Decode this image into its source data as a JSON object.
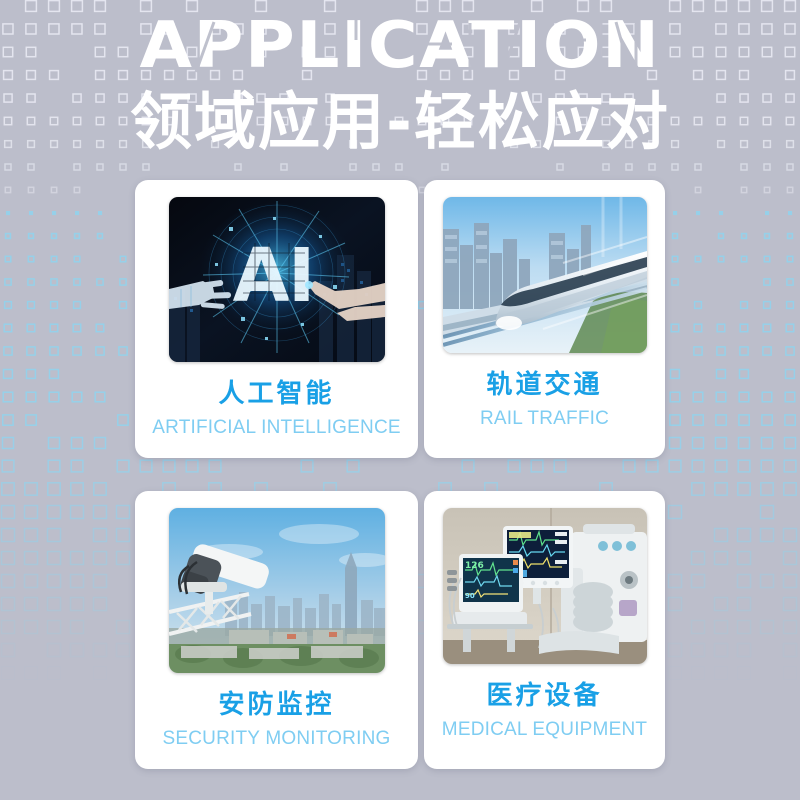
{
  "header": {
    "title_en": "APPLICATION",
    "title_cn": "领域应用-轻松应对"
  },
  "theme": {
    "background": "#bcbecb",
    "card_background": "#ffffff",
    "title_color": "#ffffff",
    "cn_label_color": "#19a0e6",
    "en_label_color": "#7fcdf2",
    "grid_white": "#e6e7f0",
    "grid_cyan": "#8fd4ef"
  },
  "cards": [
    {
      "id": "artificial-intelligence",
      "cn": "人工智能",
      "en": "ARTIFICIAL INTELLIGENCE",
      "image_alt": "ai-glowing-letters-robot-and-human-hand"
    },
    {
      "id": "rail-traffic",
      "cn": "轨道交通",
      "en": "RAIL TRAFFIC",
      "image_alt": "high-speed-maglev-train-on-elevated-track"
    },
    {
      "id": "security-monitoring",
      "cn": "安防监控",
      "en": "SECURITY MONITORING",
      "image_alt": "cctv-surveillance-camera-over-city-skyline"
    },
    {
      "id": "medical-equipment",
      "cn": "医疗设备",
      "en": "MEDICAL EQUIPMENT",
      "image_alt": "hospital-patient-monitors-and-anesthesia-machine"
    }
  ]
}
